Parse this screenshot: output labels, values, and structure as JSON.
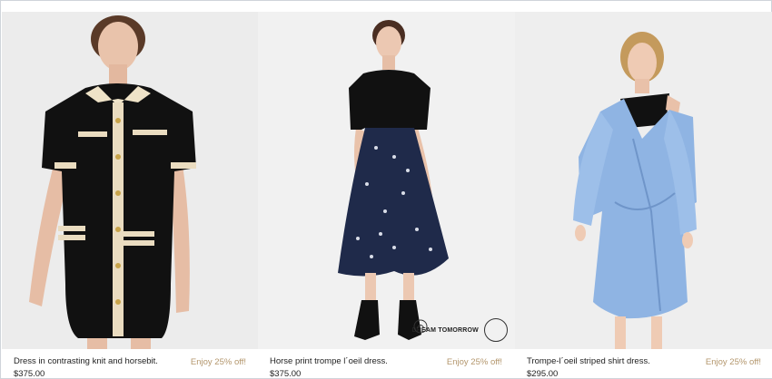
{
  "products": [
    {
      "name": "Dress in contrasting knit and horsebit.",
      "price": "$375.00",
      "promo": "Enjoy 25% off!",
      "image": "black-knit-dress-photo"
    },
    {
      "name": "Horse print trompe l´oeil dress.",
      "price": "$375.00",
      "promo": "Enjoy 25% off!",
      "image": "horse-print-dress-photo",
      "stamp_text": "DREAM TOMORROW"
    },
    {
      "name": "Trompe-l´oeil striped shirt dress.",
      "price": "$295.00",
      "promo": "Enjoy 25% off!",
      "image": "striped-shirt-dress-photo"
    }
  ],
  "colors": {
    "promo": "#b3966c",
    "text": "#222222",
    "photo_bg": "#efefef"
  }
}
